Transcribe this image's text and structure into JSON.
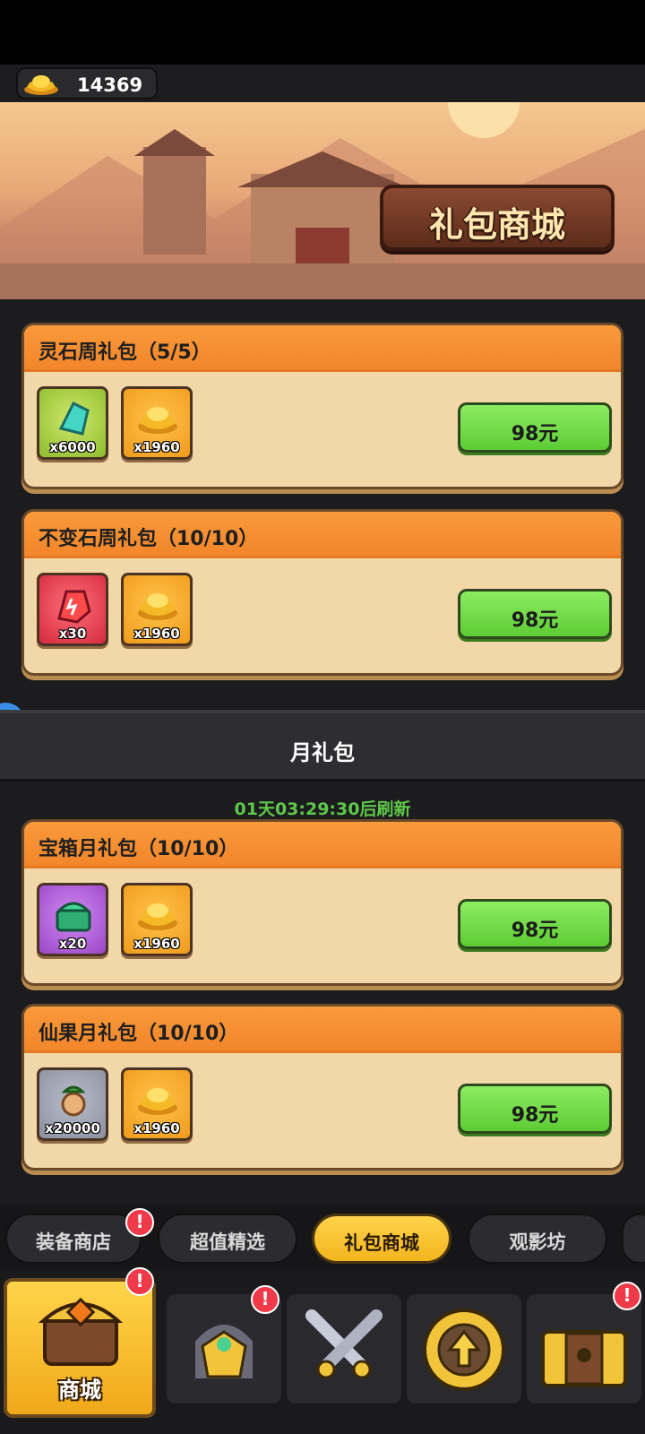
{
  "currency": {
    "amount": "14369",
    "icon": "gold-ingot-icon"
  },
  "banner": {
    "title": "礼包商城"
  },
  "weekly_cards": [
    {
      "title": "灵石周礼包（5/5）",
      "items": [
        {
          "icon": "spirit-stone-icon",
          "qty": "x6000",
          "color": "green"
        },
        {
          "icon": "gold-ingot-icon",
          "qty": "x1960",
          "color": "gold"
        }
      ],
      "price": "98元"
    },
    {
      "title": "不变石周礼包（10/10）",
      "items": [
        {
          "icon": "red-stone-icon",
          "qty": "x30",
          "color": "red"
        },
        {
          "icon": "gold-ingot-icon",
          "qty": "x1960",
          "color": "gold"
        }
      ],
      "price": "98元"
    }
  ],
  "monthly_section": {
    "title": "月礼包",
    "timer": "01天03:29:30后刷新"
  },
  "monthly_cards": [
    {
      "title": "宝箱月礼包（10/10）",
      "items": [
        {
          "icon": "jade-chest-icon",
          "qty": "x20",
          "color": "purple"
        },
        {
          "icon": "gold-ingot-icon",
          "qty": "x1960",
          "color": "gold"
        }
      ],
      "price": "98元"
    },
    {
      "title": "仙果月礼包（10/10）",
      "items": [
        {
          "icon": "immortal-fruit-icon",
          "qty": "x20000",
          "color": "gray"
        },
        {
          "icon": "gold-ingot-icon",
          "qty": "x1960",
          "color": "gold"
        }
      ],
      "price": "98元"
    }
  ],
  "tabs": [
    {
      "label": "装备商店",
      "badge": "!"
    },
    {
      "label": "超值精选"
    },
    {
      "label": "礼包商城",
      "active": true
    },
    {
      "label": "观影坊"
    }
  ],
  "navbar": {
    "shop_label": "商城",
    "badge": "!"
  }
}
